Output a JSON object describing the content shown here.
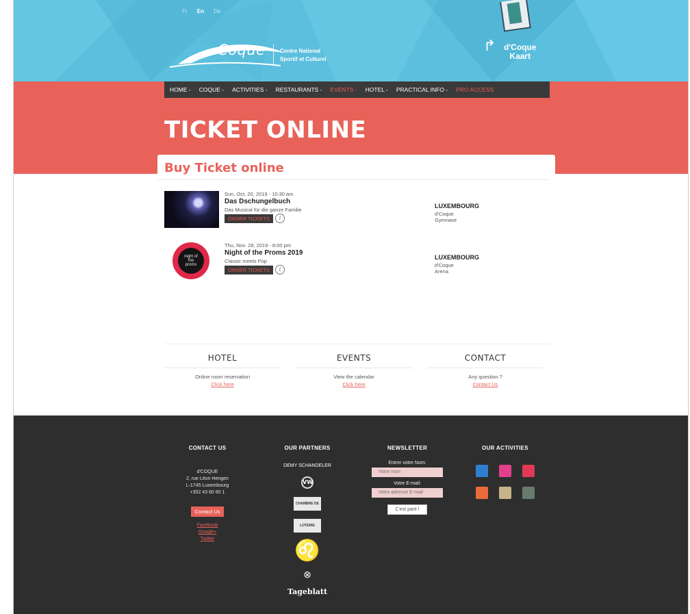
{
  "header": {
    "languages": [
      {
        "label": "Fr",
        "active": false
      },
      {
        "label": "En",
        "active": true
      },
      {
        "label": "De",
        "active": false
      }
    ],
    "logo_word": "Coque",
    "tagline_line1": "Centre National",
    "tagline_line2": "Sportif et Culturel",
    "kaart_line1": "d'Coque",
    "kaart_line2": "Kaart",
    "bg_color": "#5bbfdd"
  },
  "nav": {
    "items": [
      {
        "label": "HOME -",
        "active": false
      },
      {
        "label": "COQUE -",
        "active": false
      },
      {
        "label": "ACTIVITIES -",
        "active": false
      },
      {
        "label": "RESTAURANTS -",
        "active": false
      },
      {
        "label": "EVENTS -",
        "active": true
      },
      {
        "label": "HOTEL -",
        "active": false
      },
      {
        "label": "PRACTICAL INFO -",
        "active": false
      },
      {
        "label": "PRO ACCESS",
        "active": true
      }
    ],
    "accent_color": "#ea5a4c"
  },
  "page": {
    "title": "TICKET ONLINE",
    "section_title": "Buy Ticket online",
    "accent_color": "#e8625a"
  },
  "events": [
    {
      "date": "Sun, Oct. 20, 2019 - 10:30 am",
      "name": "Das Dschungelbuch",
      "subtitle": "Das Musical für die ganze Familie",
      "button": "ORDER TICKETS",
      "city": "LUXEMBOURG",
      "venue": "d'Coque",
      "hall": "Gymnase"
    },
    {
      "date": "Thu, Nov. 28, 2019 - 8:00 pm",
      "name": "Night of the Proms 2019",
      "subtitle": "Classic meets Pop",
      "button": "ORDER TICKETS",
      "city": "LUXEMBOURG",
      "venue": "d'Coque",
      "hall": "Arena",
      "thumb_text": "night of the proms"
    }
  ],
  "info_glyph": "i",
  "columns": [
    {
      "title": "HOTEL",
      "text": "Online room reservation",
      "link": "Click here"
    },
    {
      "title": "EVENTS",
      "text": "View the calendar",
      "link": "Click here"
    },
    {
      "title": "CONTACT",
      "text": "Any question ?",
      "link": "Contact Us"
    }
  ],
  "footer": {
    "contact": {
      "title": "CONTACT US",
      "name": "d'COQUE",
      "street": "2, rue Léon Hengen",
      "city": "L-1745 Luxembourg",
      "phone": "+352 43 60 60 1",
      "button": "Contact Us",
      "links": [
        "Facebook",
        "Google+",
        "Twitter"
      ]
    },
    "partners": {
      "title": "OUR PARTNERS",
      "demy": "DEMY SCHANDELER",
      "vw": "VW",
      "chambre": "CHAMBRE DE COMMERCE",
      "loterie": "LOTERIE NATIONALE",
      "tageblatt": "Tageblatt"
    },
    "newsletter": {
      "title": "NEWSLETTER",
      "name_label": "Entrer votre Nom:",
      "name_placeholder": "Votre nom",
      "email_label": "Votre E-mail:",
      "email_placeholder": "Votre adresse E-mail",
      "submit": "C'est parti !"
    },
    "activities": {
      "title": "OUR ACTIVITIES",
      "icons": [
        {
          "name": "swimming-icon",
          "color": "#2f7fd1"
        },
        {
          "name": "fitness-icon",
          "color": "#e2408c"
        },
        {
          "name": "wellness-icon",
          "color": "#e23a56"
        },
        {
          "name": "climbing-icon",
          "color": "#ea6a3a"
        },
        {
          "name": "restaurant-icon",
          "color": "#c8b48a"
        },
        {
          "name": "hotel-icon",
          "color": "#6a7a6a"
        }
      ]
    }
  }
}
